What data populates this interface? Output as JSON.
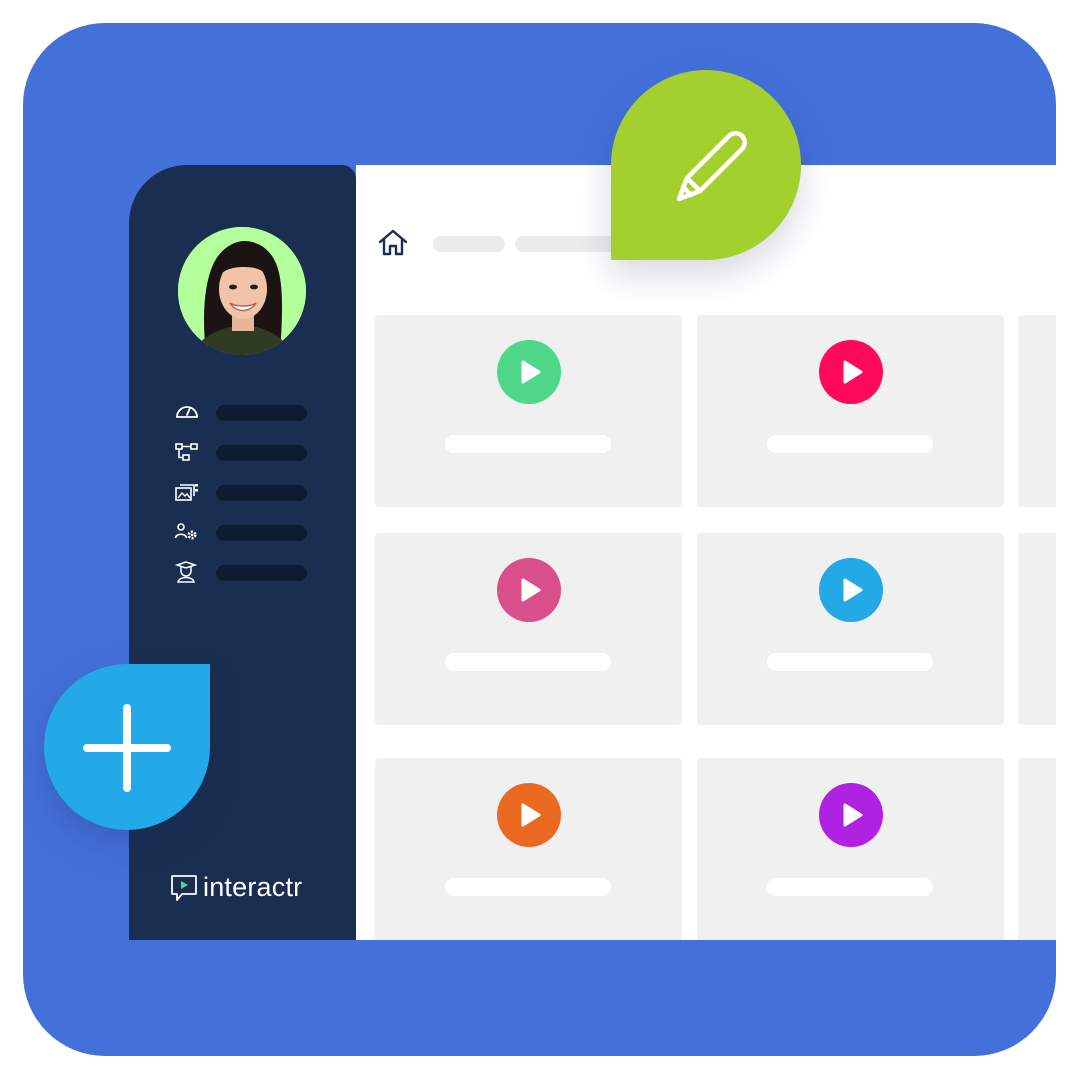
{
  "brand": {
    "name": "interactr",
    "accent": "#4470da",
    "sidebar_color": "#1a2e51"
  },
  "sidebar": {
    "avatar_bg": "#b3ff9c",
    "nav_items": [
      {
        "icon": "dashboard-gauge-icon"
      },
      {
        "icon": "flowchart-icon"
      },
      {
        "icon": "media-gallery-icon"
      },
      {
        "icon": "team-settings-icon"
      },
      {
        "icon": "graduate-icon"
      }
    ]
  },
  "header": {
    "icon": "home-icon"
  },
  "video_tiles": [
    {
      "play_color": "#4fd88a"
    },
    {
      "play_color": "#ff0a5a"
    },
    {
      "play_color": "#d94f8c"
    },
    {
      "play_color": "#22a9e6"
    },
    {
      "play_color": "#ea6a22"
    },
    {
      "play_color": "#b022e2"
    }
  ],
  "floating_actions": {
    "edit": {
      "icon": "pencil-icon",
      "color": "#a4d02f"
    },
    "add": {
      "icon": "plus-icon",
      "color": "#23a9ea"
    }
  }
}
